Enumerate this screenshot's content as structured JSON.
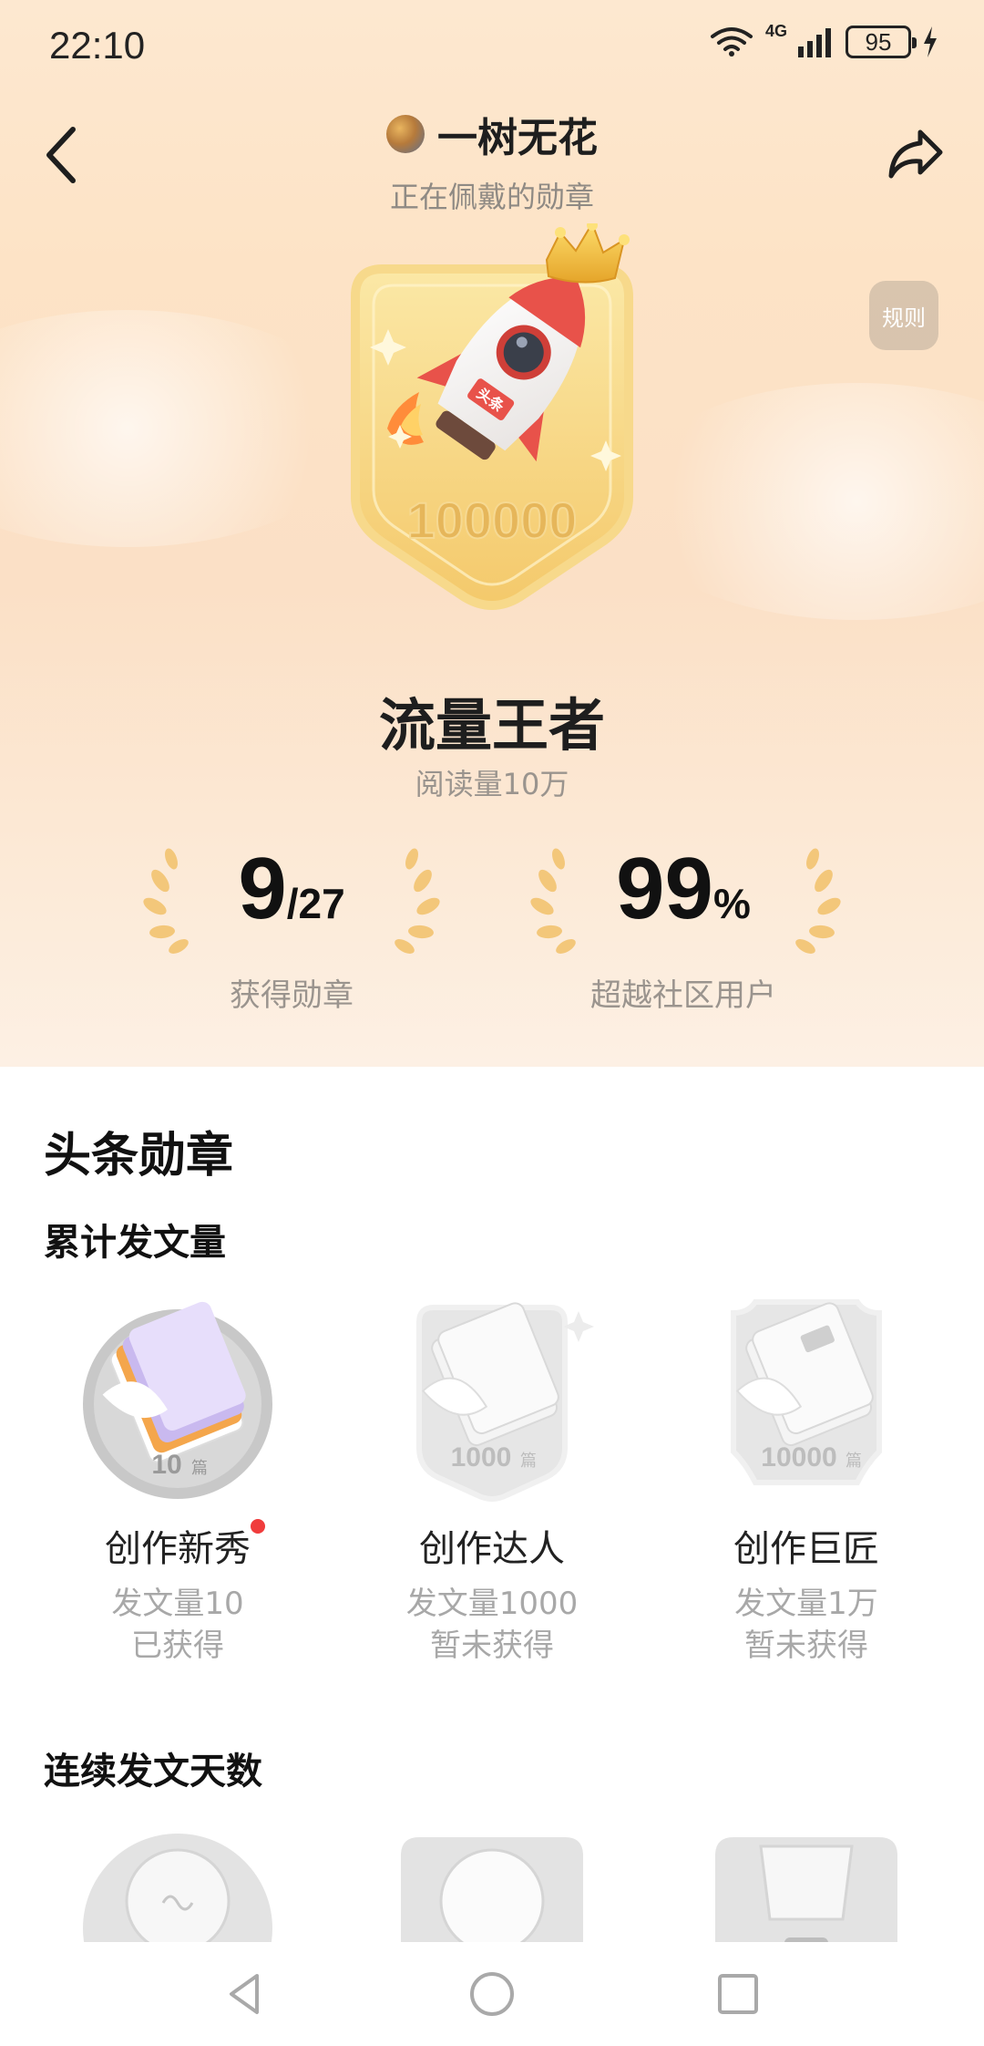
{
  "status": {
    "time": "22:10",
    "network": "4G",
    "battery": "95"
  },
  "header": {
    "user_name": "一树无花",
    "subtitle": "正在佩戴的勋章",
    "rules_label": "规则"
  },
  "current_badge": {
    "number": "100000",
    "tag": "头条",
    "name": "流量王者",
    "description": "阅读量10万"
  },
  "stats": {
    "earned_value": "9",
    "earned_total": "/27",
    "earned_label": "获得勋章",
    "percent_value": "99",
    "percent_unit": "%",
    "percent_label": "超越社区用户"
  },
  "section": {
    "title": "头条勋章",
    "group1_title": "累计发文量",
    "group2_title": "连续发文天数"
  },
  "group1_badges": [
    {
      "name": "创作新秀",
      "number": "10",
      "unit": "篇",
      "requirement": "发文量10",
      "status": "已获得",
      "earned": true
    },
    {
      "name": "创作达人",
      "number": "1000",
      "unit": "篇",
      "requirement": "发文量1000",
      "status": "暂未获得",
      "earned": false
    },
    {
      "name": "创作巨匠",
      "number": "10000",
      "unit": "篇",
      "requirement": "发文量1万",
      "status": "暂未获得",
      "earned": false
    }
  ],
  "icons": {
    "back": "chevron-left-icon",
    "share": "share-icon",
    "nav_back": "triangle-back-icon",
    "nav_home": "circle-home-icon",
    "nav_recent": "square-recent-icon"
  }
}
